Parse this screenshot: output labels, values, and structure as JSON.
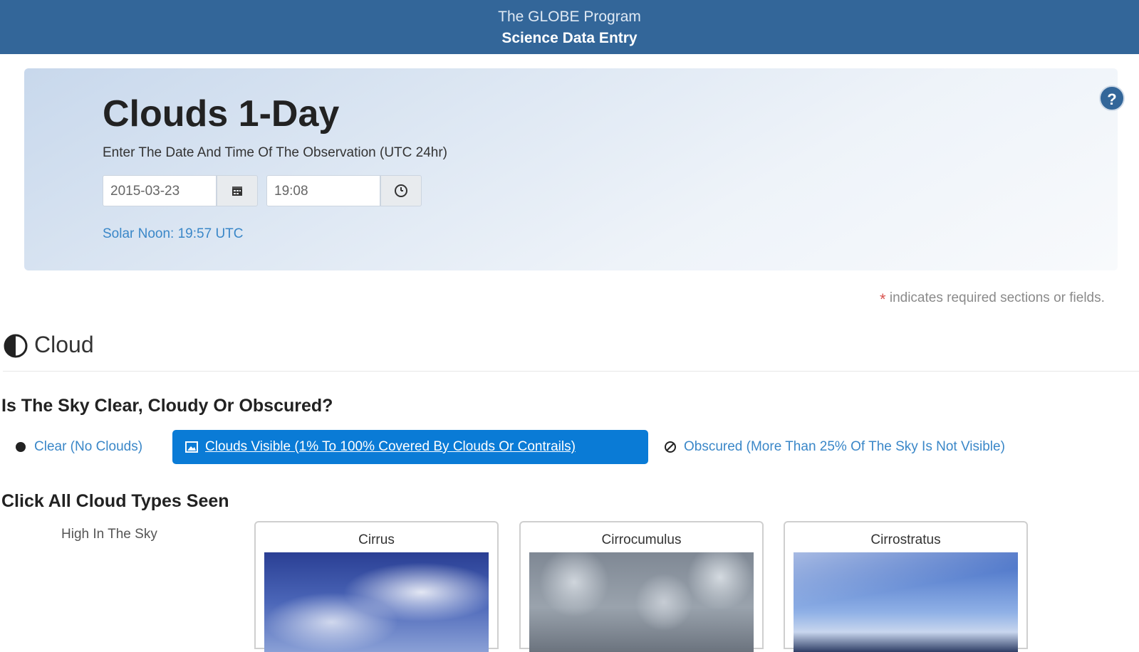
{
  "header": {
    "program": "The GLOBE Program",
    "app_title": "Science Data Entry"
  },
  "hero": {
    "title": "Clouds 1-Day",
    "subtitle": "Enter The Date And Time Of The Observation (UTC 24hr)",
    "date_value": "2015-03-23",
    "time_value": "19:08",
    "solar_noon": "Solar Noon: 19:57 UTC",
    "help_icon": "question-mark-icon"
  },
  "required_note": {
    "star": "*",
    "text": "indicates required sections or fields."
  },
  "section": {
    "label": "Cloud",
    "icon": "half-circle-icon"
  },
  "sky_question": {
    "label": "Is The Sky Clear, Cloudy Or Obscured?",
    "options": [
      {
        "label": "Clear (No Clouds)",
        "selected": false,
        "icon": "filled-circle-icon"
      },
      {
        "label": "Clouds Visible (1% To 100% Covered By Clouds Or Contrails)",
        "selected": true,
        "icon": "image-icon"
      },
      {
        "label": "Obscured (More Than 25% Of The Sky Is Not Visible)",
        "selected": false,
        "icon": "obscured-icon"
      }
    ]
  },
  "cloud_types": {
    "label": "Click All Cloud Types Seen",
    "level": "High In The Sky",
    "cards": [
      {
        "name": "Cirrus"
      },
      {
        "name": "Cirrocumulus"
      },
      {
        "name": "Cirrostratus"
      }
    ]
  },
  "colors": {
    "header_bg": "#336699",
    "selected_option_bg": "#0a7bd6",
    "link": "#3a87c8",
    "required_star": "#d9534f"
  }
}
